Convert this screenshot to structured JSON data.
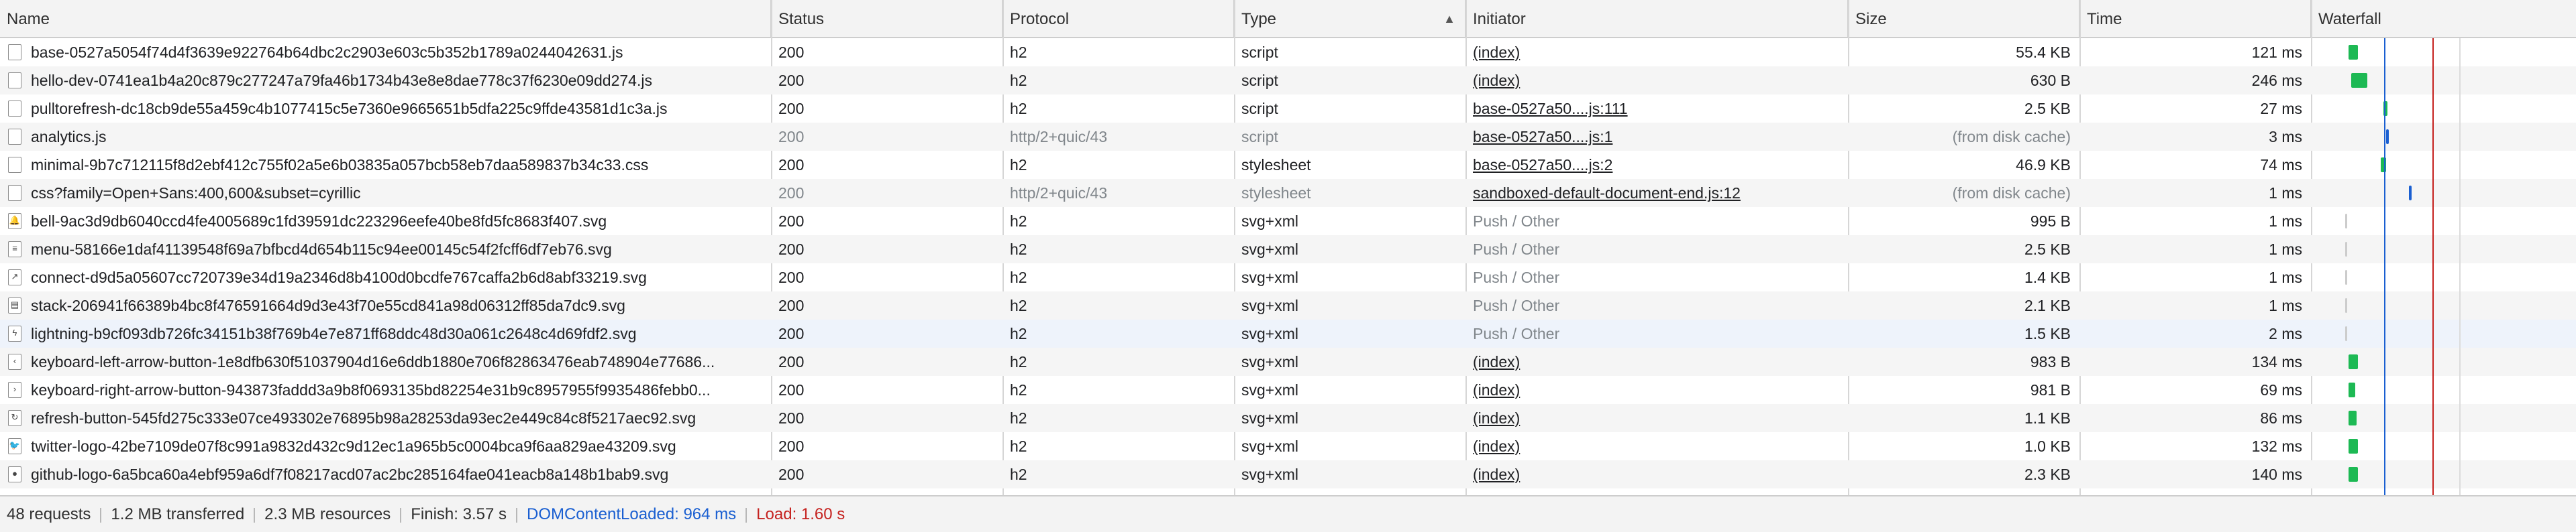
{
  "columns": [
    {
      "label": "Name"
    },
    {
      "label": "Status"
    },
    {
      "label": "Protocol"
    },
    {
      "label": "Type"
    },
    {
      "label": "Initiator"
    },
    {
      "label": "Size"
    },
    {
      "label": "Time"
    },
    {
      "label": "Waterfall"
    }
  ],
  "sort_indicator": "▲",
  "rows": [
    {
      "name": "base-0527a5054f74d4f3639e922764b64dbc2c2903e603c5b352b1789a0244042631.js",
      "status": "200",
      "protocol": "h2",
      "type": "script",
      "initiator": "(index)",
      "size": "55.4 KB",
      "time": "121 ms"
    },
    {
      "name": "hello-dev-0741ea1b4a20c879c277247a79fa46b1734b43e8e8dae778c37f6230e09dd274.js",
      "status": "200",
      "protocol": "h2",
      "type": "script",
      "initiator": "(index)",
      "size": "630 B",
      "time": "246 ms"
    },
    {
      "name": "pulltorefresh-dc18cb9de55a459c4b1077415c5e7360e9665651b5dfa225c9ffde43581d1c3a.js",
      "status": "200",
      "protocol": "h2",
      "type": "script",
      "initiator": "base-0527a50....js:111",
      "size": "2.5 KB",
      "time": "27 ms"
    },
    {
      "name": "analytics.js",
      "status": "200",
      "protocol": "http/2+quic/43",
      "type": "script",
      "initiator": "base-0527a50....js:1",
      "size": "(from disk cache)",
      "time": "3 ms"
    },
    {
      "name": "minimal-9b7c712115f8d2ebf412c755f02a5e6b03835a057bcb58eb7daa589837b34c33.css",
      "status": "200",
      "protocol": "h2",
      "type": "stylesheet",
      "initiator": "base-0527a50....js:2",
      "size": "46.9 KB",
      "time": "74 ms"
    },
    {
      "name": "css?family=Open+Sans:400,600&subset=cyrillic",
      "status": "200",
      "protocol": "http/2+quic/43",
      "type": "stylesheet",
      "initiator": "sandboxed-default-document-end.js:12",
      "size": "(from disk cache)",
      "time": "1 ms"
    },
    {
      "name": "bell-9ac3d9db6040ccd4fe4005689c1fd39591dc223296eefe40be8fd5fc8683f407.svg",
      "status": "200",
      "protocol": "h2",
      "type": "svg+xml",
      "initiator": "Push / Other",
      "size": "995 B",
      "time": "1 ms"
    },
    {
      "name": "menu-58166e1daf41139548f69a7bfbcd4d654b115c94ee00145c54f2fcff6df7eb76.svg",
      "status": "200",
      "protocol": "h2",
      "type": "svg+xml",
      "initiator": "Push / Other",
      "size": "2.5 KB",
      "time": "1 ms"
    },
    {
      "name": "connect-d9d5a05607cc720739e34d19a2346d8b4100d0bcdfe767caffa2b6d8abf33219.svg",
      "status": "200",
      "protocol": "h2",
      "type": "svg+xml",
      "initiator": "Push / Other",
      "size": "1.4 KB",
      "time": "1 ms"
    },
    {
      "name": "stack-206941f66389b4bc8f476591664d9d3e43f70e55cd841a98d06312ff85da7dc9.svg",
      "status": "200",
      "protocol": "h2",
      "type": "svg+xml",
      "initiator": "Push / Other",
      "size": "2.1 KB",
      "time": "1 ms"
    },
    {
      "name": "lightning-b9cf093db726fc34151b38f769b4e7e871ff68ddc48d30a061c2648c4d69fdf2.svg",
      "status": "200",
      "protocol": "h2",
      "type": "svg+xml",
      "initiator": "Push / Other",
      "size": "1.5 KB",
      "time": "2 ms"
    },
    {
      "name": "keyboard-left-arrow-button-1e8dfb630f51037904d16e6ddb1880e706f82863476eab748904e77686...",
      "status": "200",
      "protocol": "h2",
      "type": "svg+xml",
      "initiator": "(index)",
      "size": "983 B",
      "time": "134 ms"
    },
    {
      "name": "keyboard-right-arrow-button-943873faddd3a9b8f0693135bd82254e31b9c8957955f9935486febb0...",
      "status": "200",
      "protocol": "h2",
      "type": "svg+xml",
      "initiator": "(index)",
      "size": "981 B",
      "time": "69 ms"
    },
    {
      "name": "refresh-button-545fd275c333e07ce493302e76895b98a28253da93ec2e449c84c8f5217aec92.svg",
      "status": "200",
      "protocol": "h2",
      "type": "svg+xml",
      "initiator": "(index)",
      "size": "1.1 KB",
      "time": "86 ms"
    },
    {
      "name": "twitter-logo-42be7109de07f8c991a9832d432c9d12ec1a965b5c0004bca9f6aa829ae43209.svg",
      "status": "200",
      "protocol": "h2",
      "type": "svg+xml",
      "initiator": "(index)",
      "size": "1.0 KB",
      "time": "132 ms"
    },
    {
      "name": "github-logo-6a5bca60a4ebf959a6df7f08217acd07ac2bc285164fae041eacb8a148b1bab9.svg",
      "status": "200",
      "protocol": "h2",
      "type": "svg+xml",
      "initiator": "(index)",
      "size": "2.3 KB",
      "time": "140 ms"
    }
  ],
  "summary": {
    "requests": "48 requests",
    "transferred": "1.2 MB transferred",
    "resources": "2.3 MB resources",
    "finish": "Finish: 3.57 s",
    "dcl": "DOMContentLoaded: 964 ms",
    "load": "Load: 1.60 s"
  },
  "colors": {
    "waterfall_bar": "#1db954",
    "dcl_line": "#1a5fd1",
    "load_line": "#c5221f"
  }
}
